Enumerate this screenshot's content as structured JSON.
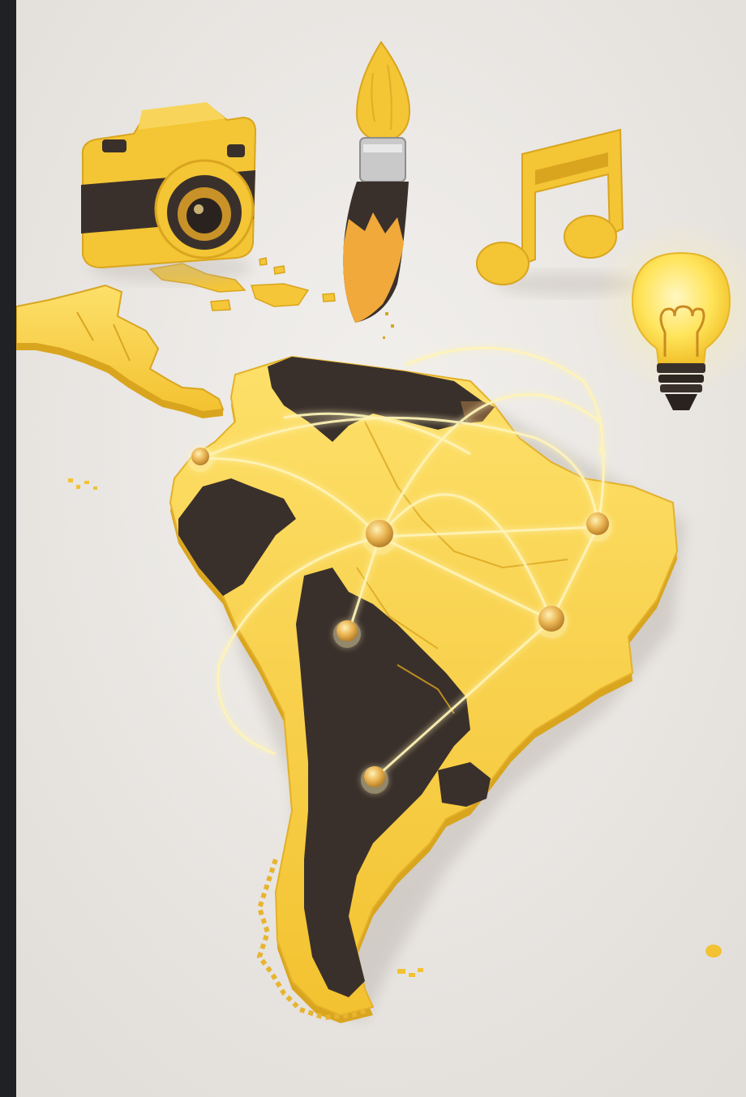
{
  "image": {
    "subject": "",
    "objects": [
      "camera-icon",
      "paintbrush-icon",
      "music-note-icon",
      "light-bulb-icon",
      "south-america-map",
      "network-node",
      "network-arc"
    ]
  },
  "colors": {
    "background": "#ece9e6",
    "frame": "#1f2125",
    "yellow": "#f7cd3c",
    "yellow_light": "#fde06a",
    "yellow_shadow": "#d9a51f",
    "dark": "#3a302b",
    "glow": "#fff4b8",
    "node": "#e2a43a"
  }
}
